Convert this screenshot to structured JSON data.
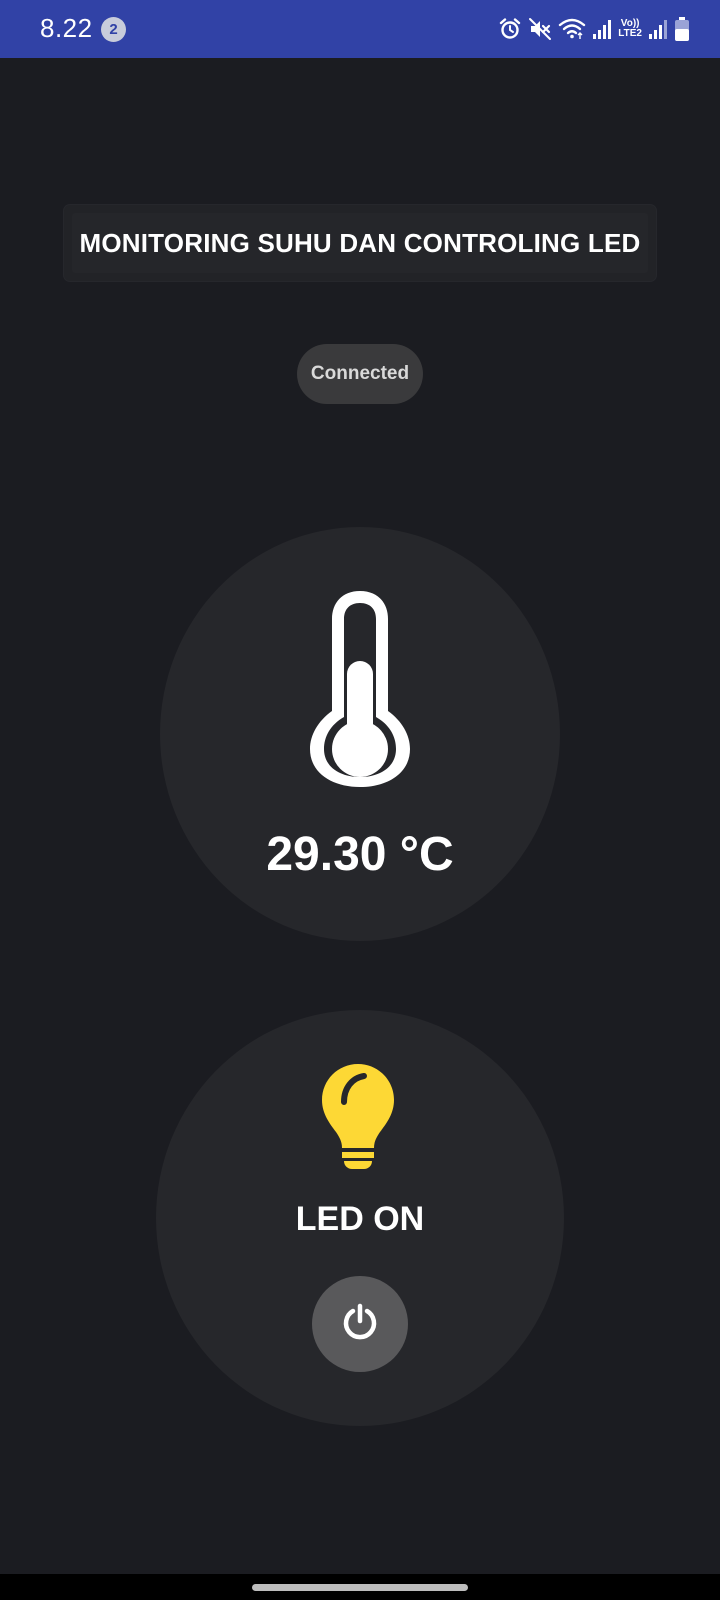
{
  "status_bar": {
    "time": "8.22",
    "notification_count": "2",
    "volte_label_top": "Vo))",
    "volte_label_bottom": "LTE2",
    "icons": [
      "alarm-icon",
      "mute-icon",
      "wifi-icon",
      "signal-icon",
      "volte-icon",
      "signal-icon",
      "battery-icon"
    ]
  },
  "header": {
    "title": "MONITORING SUHU DAN CONTROLING LED"
  },
  "connection": {
    "status": "Connected"
  },
  "temperature": {
    "icon": "thermometer-icon",
    "value": "29.30 °C"
  },
  "led": {
    "icon": "lightbulb-icon",
    "state_label": "LED ON",
    "toggle_icon": "power-icon"
  },
  "colors": {
    "status_bar": "#3142a6",
    "background": "#1b1c21",
    "card": "#26272b",
    "bulb": "#fdd835",
    "pill": "#3a3a3c",
    "power_button": "#59595b"
  }
}
